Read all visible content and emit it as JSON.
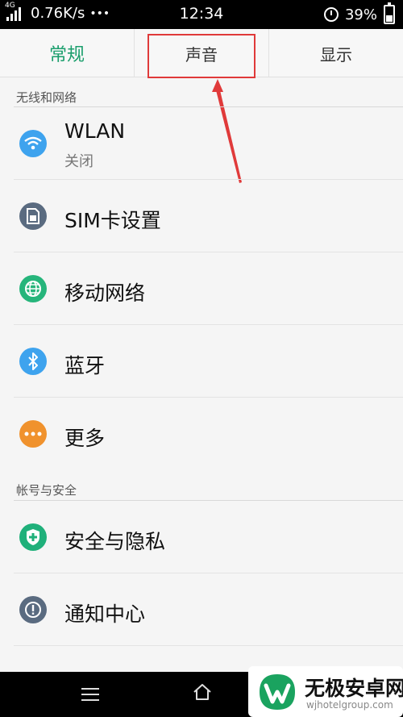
{
  "status_bar": {
    "network": "4G",
    "speed": "0.76K/s",
    "dots": "•••",
    "time": "12:34",
    "battery": "39%"
  },
  "tabs": [
    {
      "label": "常规",
      "active": true
    },
    {
      "label": "声音",
      "active": false
    },
    {
      "label": "显示",
      "active": false
    }
  ],
  "sections": [
    {
      "label": "无线和网络",
      "items": [
        {
          "title": "WLAN",
          "subtitle": "关闭",
          "icon": "wifi-icon",
          "color": "#3ea3ee"
        },
        {
          "title": "SIM卡设置",
          "icon": "sim-card-icon",
          "color": "#5a6b80"
        },
        {
          "title": "移动网络",
          "icon": "globe-icon",
          "color": "#26b57b"
        },
        {
          "title": "蓝牙",
          "icon": "bluetooth-icon",
          "color": "#3ea3ee"
        },
        {
          "title": "更多",
          "icon": "more-dots-icon",
          "color": "#f0922d"
        }
      ]
    },
    {
      "label": "帐号与安全",
      "items": [
        {
          "title": "安全与隐私",
          "icon": "shield-icon",
          "color": "#1fb07a"
        },
        {
          "title": "通知中心",
          "icon": "alert-icon",
          "color": "#5a6b80"
        }
      ]
    }
  ],
  "watermark": {
    "title": "无极安卓网",
    "url": "wjhotelgroup.com"
  },
  "colors": {
    "accent": "#1a9e6c",
    "highlight": "#e03a3a",
    "annotation": "#e03a3a"
  }
}
